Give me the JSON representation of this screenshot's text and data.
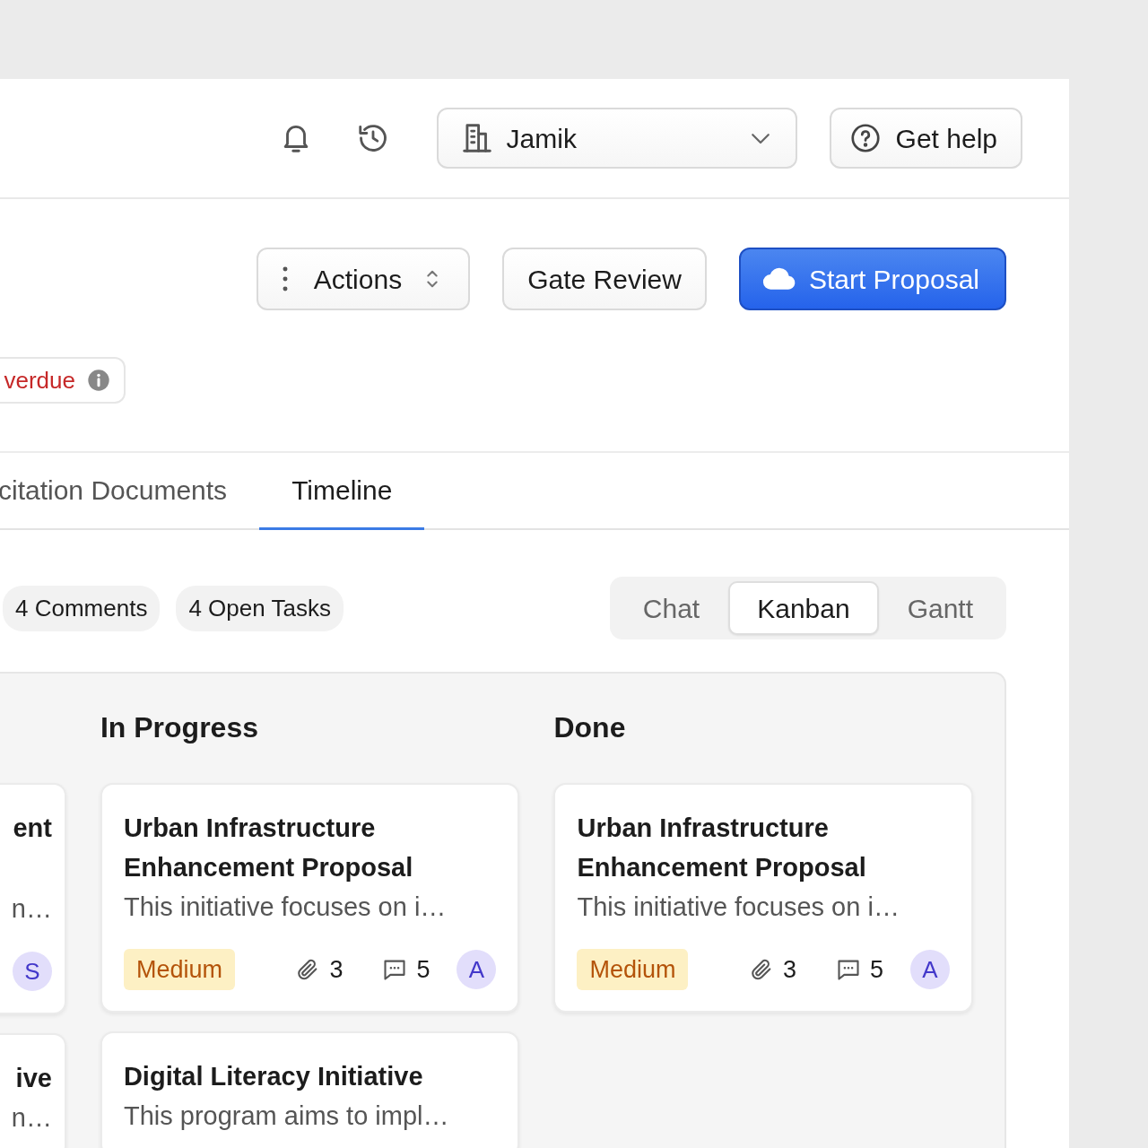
{
  "header": {
    "workspace": "Jamik",
    "help_button": "Get help"
  },
  "actions": [
    {
      "label": "Actions",
      "kind": "menu"
    },
    {
      "label": "Gate Review",
      "kind": "secondary"
    },
    {
      "label": "Start Proposal",
      "kind": "primary"
    }
  ],
  "status_badge": {
    "label": "verdue"
  },
  "tabs": [
    {
      "label": "citation Documents",
      "selected": false
    },
    {
      "label": "Timeline",
      "selected": true
    }
  ],
  "counts": [
    "4 Comments",
    "4 Open Tasks"
  ],
  "view_switch": [
    {
      "label": "Chat",
      "selected": false
    },
    {
      "label": "Kanban",
      "selected": true
    },
    {
      "label": "Gantt",
      "selected": false
    }
  ],
  "board": {
    "columns": [
      {
        "cards": [
          {
            "title": "ent",
            "description": "n…",
            "assignee": "S"
          },
          {
            "title": "ive",
            "description": "n…"
          }
        ]
      },
      {
        "title": "In Progress",
        "cards": [
          {
            "title": "Urban Infrastructure Enhancement Proposal",
            "description": "This initiative focuses on i…",
            "priority": "Medium",
            "attachments": "3",
            "comments": "5",
            "assignee": "A"
          },
          {
            "title": "Digital Literacy Initiative",
            "description": "This program aims to impl…"
          }
        ]
      },
      {
        "title": "Done",
        "cards": [
          {
            "title": "Urban Infrastructure Enhancement Proposal",
            "description": "This initiative focuses on i…",
            "priority": "Medium",
            "attachments": "3",
            "comments": "5",
            "assignee": "A"
          }
        ]
      }
    ]
  }
}
